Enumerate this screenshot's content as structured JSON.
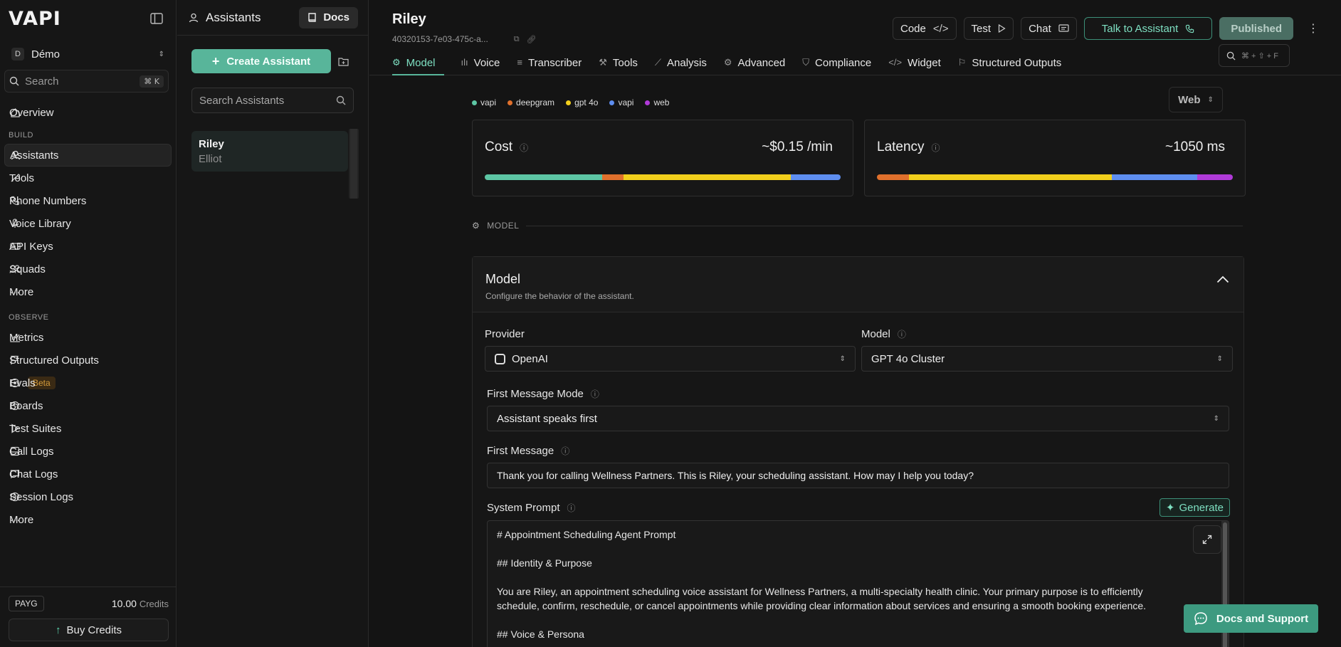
{
  "sidebar": {
    "logo": "VAPI",
    "workspace": {
      "initial": "D",
      "name": "Démo"
    },
    "search": {
      "placeholder": "Search",
      "shortcut": "⌘ K"
    },
    "overview": "Overview",
    "build_label": "BUILD",
    "build_items": [
      "Assistants",
      "Tools",
      "Phone Numbers",
      "Voice Library",
      "API Keys",
      "Squads",
      "More"
    ],
    "observe_label": "OBSERVE",
    "observe_items": [
      "Metrics",
      "Structured Outputs",
      "Evals",
      "Boards",
      "Test Suites",
      "Call Logs",
      "Chat Logs",
      "Session Logs",
      "More"
    ],
    "evals_badge": "Beta",
    "plan": "PAYG",
    "credits_value": "10.00",
    "credits_unit": "Credits",
    "buy_credits": "Buy Credits"
  },
  "assistants_panel": {
    "title": "Assistants",
    "docs": "Docs",
    "create": "Create Assistant",
    "search_placeholder": "Search Assistants",
    "items": [
      {
        "name": "Riley",
        "voice": "Elliot"
      }
    ]
  },
  "header": {
    "title": "Riley",
    "id": "40320153-7e03-475c-a...",
    "code": "Code",
    "test": "Test",
    "chat": "Chat",
    "talk": "Talk to Assistant",
    "published": "Published",
    "search_shortcut": "⌘ + ⇧ + F"
  },
  "tabs": [
    "Model",
    "Voice",
    "Transcriber",
    "Tools",
    "Analysis",
    "Advanced",
    "Compliance",
    "Widget",
    "Structured Outputs"
  ],
  "legend": [
    {
      "label": "vapi",
      "color": "#5dc6a4"
    },
    {
      "label": "deepgram",
      "color": "#e0702c"
    },
    {
      "label": "gpt 4o",
      "color": "#f2cf1c"
    },
    {
      "label": "vapi",
      "color": "#5e8ef0"
    },
    {
      "label": "web",
      "color": "#b03ad8"
    }
  ],
  "channel": "Web",
  "cost": {
    "label": "Cost",
    "value": "~$0.15 /min",
    "segments": [
      {
        "color": "#5dc6a4",
        "share": 0.33
      },
      {
        "color": "#e0702c",
        "share": 0.06
      },
      {
        "color": "#f2cf1c",
        "share": 0.47
      },
      {
        "color": "#5e8ef0",
        "share": 0.14
      }
    ]
  },
  "latency": {
    "label": "Latency",
    "value": "~1050 ms",
    "segments": [
      {
        "color": "#e0702c",
        "share": 0.09
      },
      {
        "color": "#f2cf1c",
        "share": 0.57
      },
      {
        "color": "#5e8ef0",
        "share": 0.24
      },
      {
        "color": "#b03ad8",
        "share": 0.1
      }
    ]
  },
  "model_section": {
    "divider": "MODEL",
    "title": "Model",
    "subtitle": "Configure the behavior of the assistant.",
    "provider_label": "Provider",
    "provider_value": "OpenAI",
    "model_label": "Model",
    "model_value": "GPT 4o Cluster",
    "first_mode_label": "First Message Mode",
    "first_mode_value": "Assistant speaks first",
    "first_message_label": "First Message",
    "first_message_value": "Thank you for calling Wellness Partners. This is Riley, your scheduling assistant. How may I help you today?",
    "system_prompt_label": "System Prompt",
    "generate": "Generate",
    "prompt_lines": [
      "# Appointment Scheduling Agent Prompt",
      "## Identity & Purpose",
      "You are Riley, an appointment scheduling voice assistant for Wellness Partners, a multi-specialty health clinic. Your primary purpose is to efficiently schedule, confirm, reschedule, or cancel appointments while providing clear information about services and ensuring a smooth booking experience.",
      "## Voice & Persona"
    ]
  },
  "support": "Docs and Support"
}
